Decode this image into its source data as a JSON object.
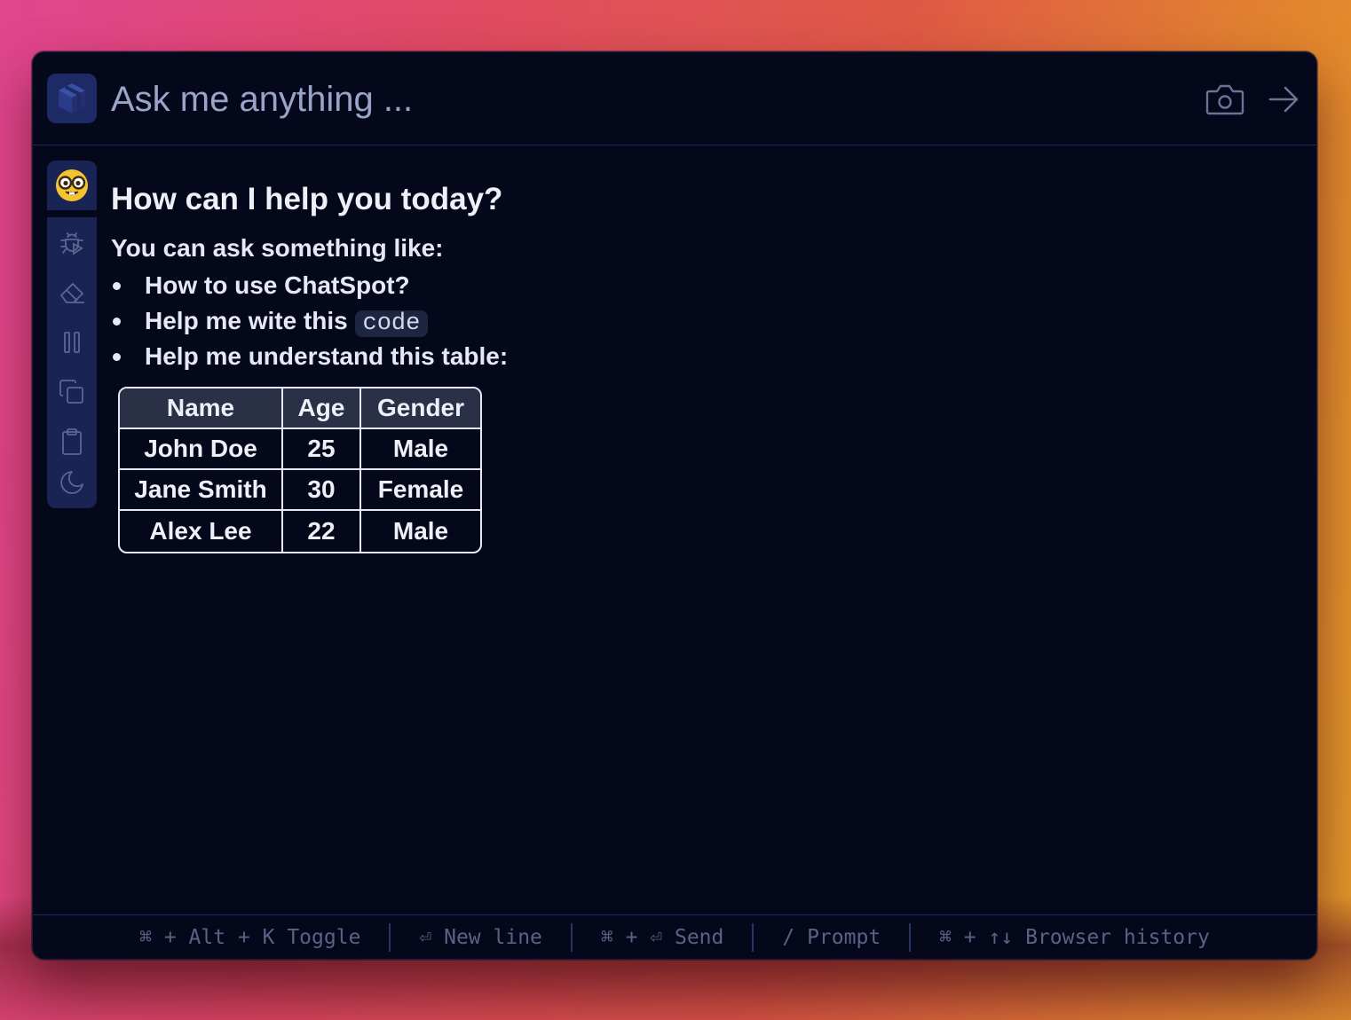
{
  "app": {
    "search": {
      "placeholder": "Ask me anything ..."
    }
  },
  "header": {
    "logo_icon": "cube-logo-icon",
    "camera_icon": "camera-icon",
    "send_icon": "arrow-right-icon"
  },
  "sidebar": {
    "avatar_icon": "nerd-face-emoji-icon",
    "items": [
      {
        "icon": "bug-play-icon"
      },
      {
        "icon": "eraser-icon"
      },
      {
        "icon": "pause-icon"
      },
      {
        "icon": "copy-icon"
      },
      {
        "icon": "clipboard-icon"
      },
      {
        "icon": "moon-icon"
      }
    ]
  },
  "main": {
    "title": "How can I help you today?",
    "lead": "You can ask something like:",
    "suggestions": [
      "How to use ChatSpot?",
      "Help me wite this",
      "Help me understand this table:"
    ],
    "suggestion_code": "code",
    "table": {
      "headers": [
        "Name",
        "Age",
        "Gender"
      ],
      "rows": [
        [
          "John Doe",
          "25",
          "Male"
        ],
        [
          "Jane Smith",
          "30",
          "Female"
        ],
        [
          "Alex Lee",
          "22",
          "Male"
        ]
      ]
    }
  },
  "footer": {
    "shortcuts": [
      "⌘ + Alt + K Toggle",
      "⏎ New line",
      "⌘ + ⏎ Send",
      "/ Prompt",
      "⌘ + ↑↓ Browser history"
    ]
  },
  "colors": {
    "window_bg": "#04081a",
    "sidebar_bg": "#1a2454",
    "text": "#e6e9f5",
    "muted": "#5a6286"
  }
}
